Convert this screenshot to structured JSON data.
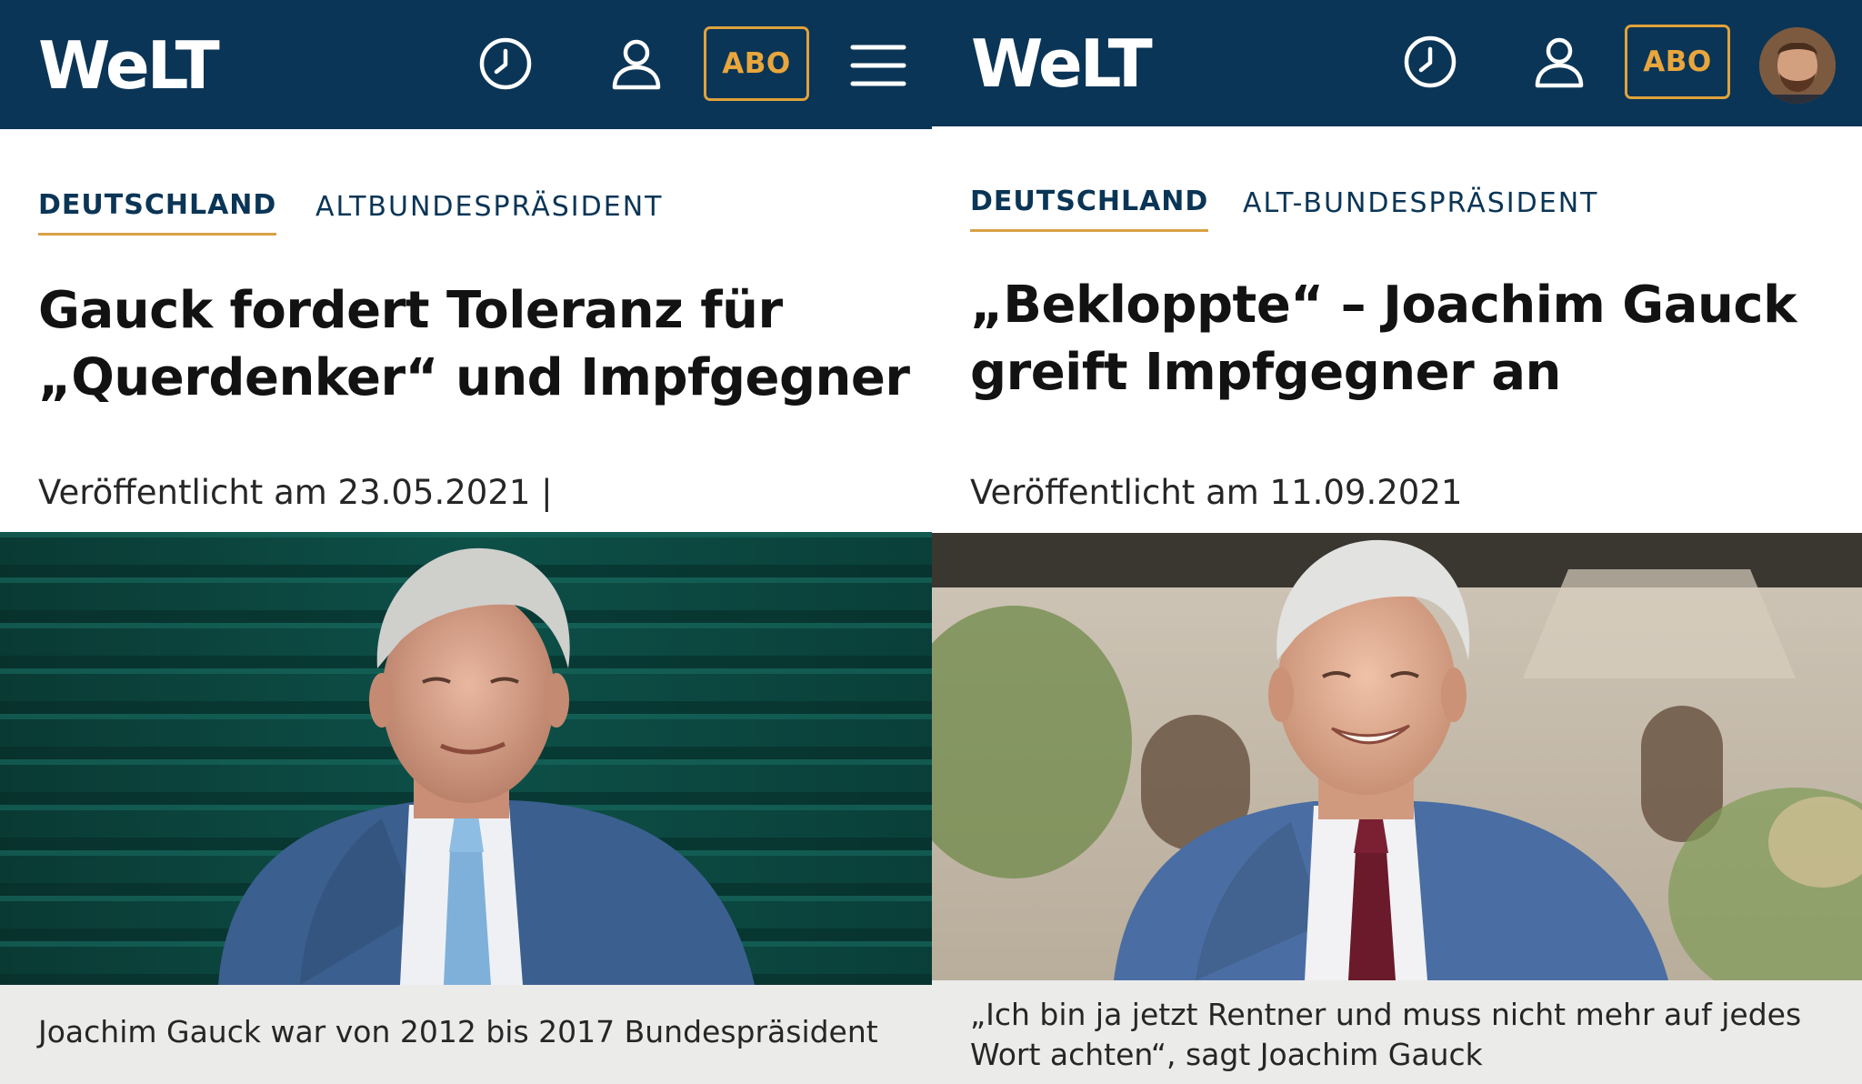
{
  "left": {
    "header": {
      "logo": "WeLT",
      "abo_label": "ABO",
      "icons": [
        "clock-icon",
        "user-icon",
        "menu-icon"
      ]
    },
    "categories": {
      "primary": "DEUTSCHLAND",
      "secondary": "ALTBUNDESPRÄSIDENT"
    },
    "headline": "Gauck fordert Toleranz für „Querdenker“ und Impfgegner",
    "published": "Veröffentlicht am 23.05.2021 |",
    "caption": "Joachim Gauck war von 2012 bis 2017 Bundespräsident"
  },
  "right": {
    "header": {
      "logo": "WeLT",
      "abo_label": "ABO",
      "icons": [
        "clock-icon",
        "user-icon",
        "avatar"
      ]
    },
    "categories": {
      "primary": "DEUTSCHLAND",
      "secondary": "ALT-BUNDESPRÄSIDENT"
    },
    "headline": "„Bekloppte“ – Joachim Gauck greift Impfgegner an",
    "published": "Veröffentlicht am  11.09.2021",
    "caption": "„Ich bin ja jetzt Rentner und muss nicht mehr auf jedes Wort achten“, sagt Joachim Gauck"
  },
  "colors": {
    "header_bg": "#0a3556",
    "abo_accent": "#e0a23b",
    "category_underline": "#d9a246",
    "caption_bg": "#ebebea"
  }
}
